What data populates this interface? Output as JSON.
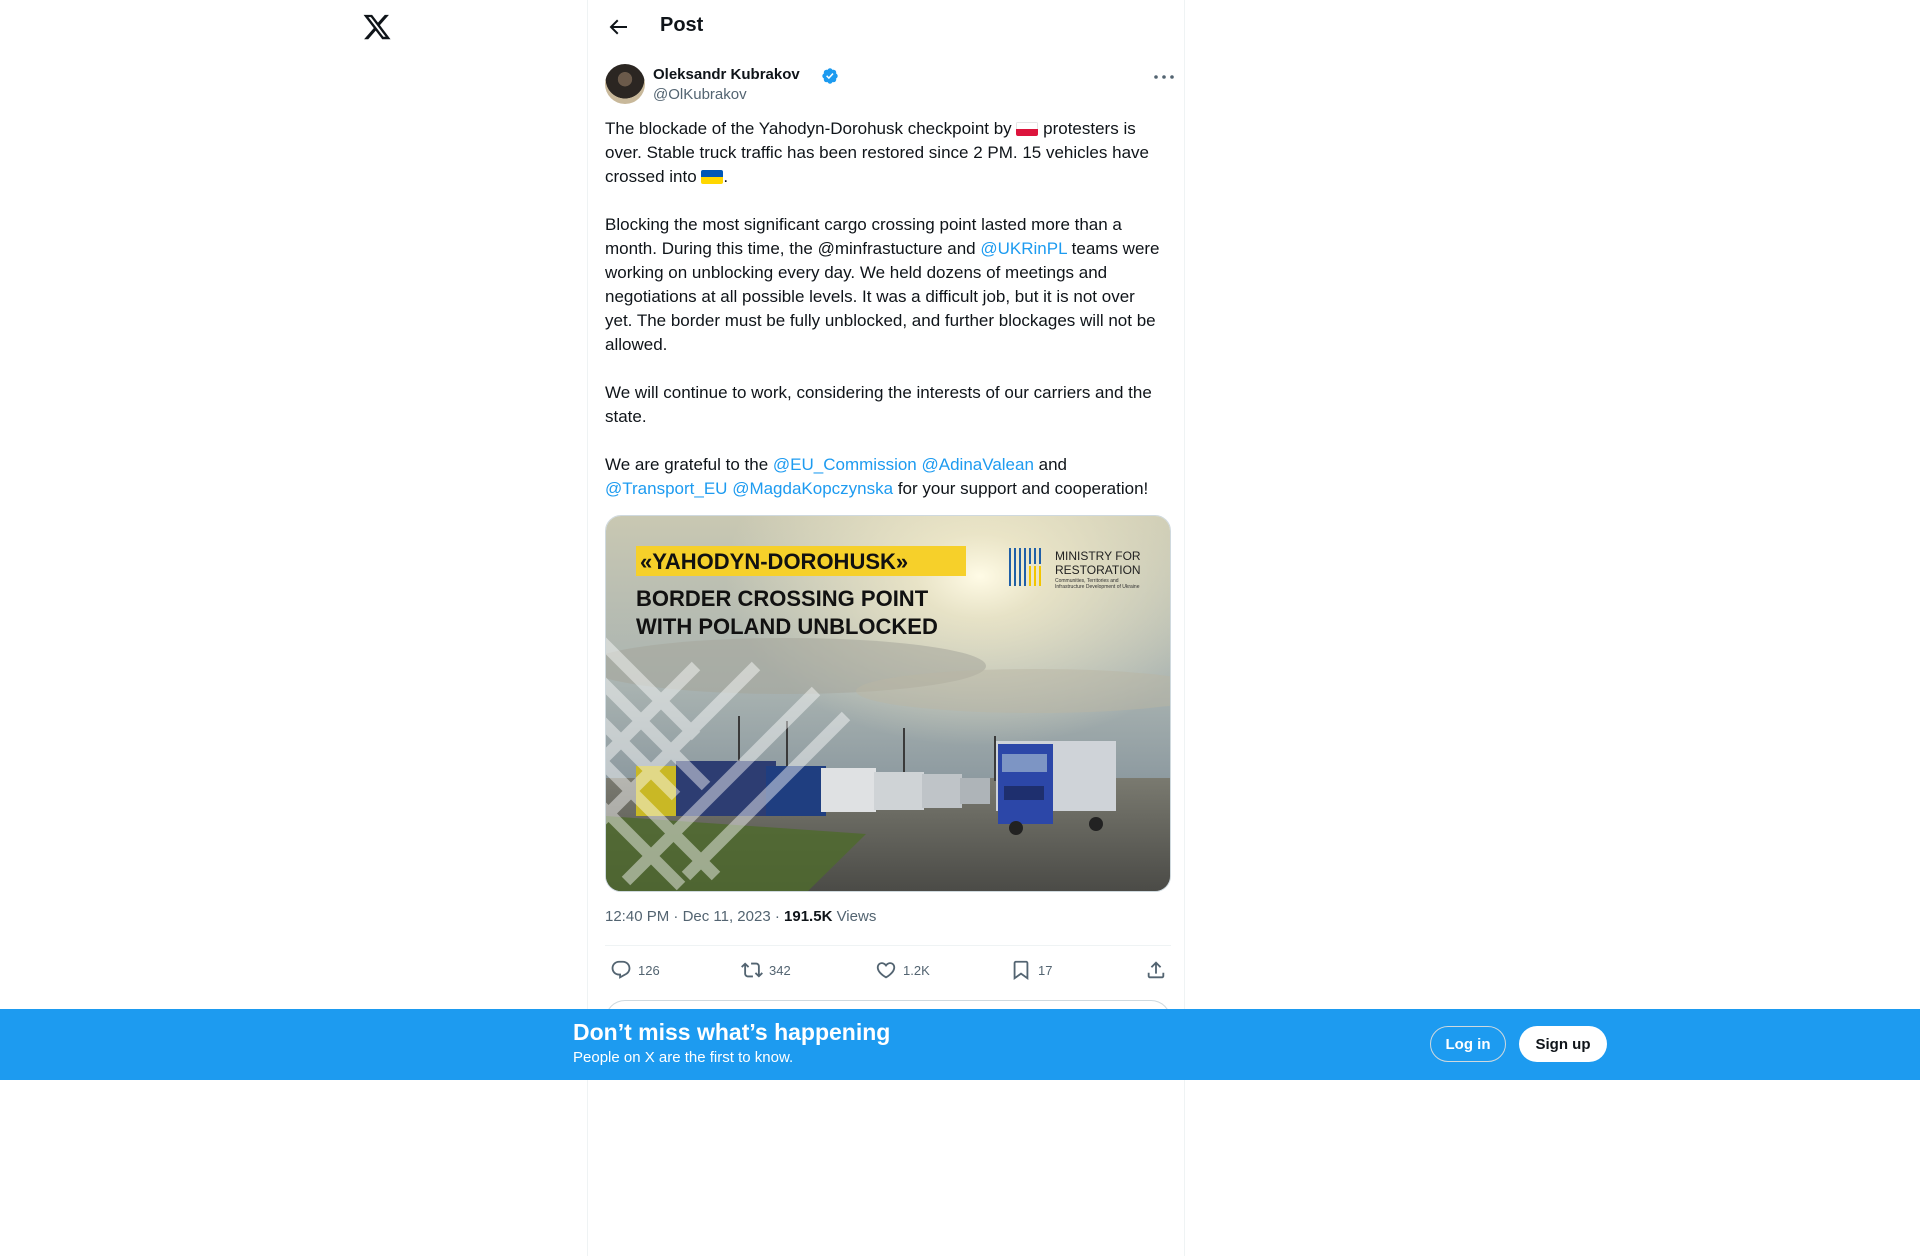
{
  "header": {
    "title": "Post",
    "logo_icon": "x-logo-icon",
    "back_icon": "arrow-left-icon"
  },
  "author": {
    "name": "Oleksandr Kubrakov",
    "handle": "@OlKubrakov",
    "verified": true
  },
  "tweet": {
    "p1_a": "The blockade of the Yahodyn-Dorohusk checkpoint by ",
    "p1_b": " protesters is over. Stable truck traffic has been restored since 2 PM. 15 vehicles have crossed into ",
    "p1_c": ".",
    "p2_a": "Blocking the most significant cargo crossing point lasted more than a month. During this time, the @minfrastucture and ",
    "p2_mention": "@UKRinPL",
    "p2_b": " teams were working on unblocking every day. We held dozens of meetings and negotiations at all possible levels. It was a difficult job, but it is not over yet. The border must be fully unblocked, and further blockages will not be allowed.",
    "p3": "We will continue to work, considering the interests of our carriers and the state.",
    "p4_a": "We are grateful to the ",
    "p4_m1": "@EU_Commission",
    "p4_m2": "@AdinaValean",
    "p4_b": " and",
    "p4_m3": "@Transport_EU",
    "p4_m4": "@MagdaKopczynska",
    "p4_c": " for your support and cooperation!",
    "flag_poland": {
      "top": "#ffffff",
      "bottom": "#dc143c"
    },
    "flag_ukraine": {
      "top": "#0057b7",
      "bottom": "#ffd700"
    }
  },
  "media": {
    "headline": "«YAHODYN-DOROHUSK»",
    "subhead_1": "BORDER CROSSING POINT",
    "subhead_2": "WITH POLAND UNBLOCKED",
    "brand_1": "MINISTRY FOR",
    "brand_2": "RESTORATION",
    "brand_small_1": "Communities, Territories and",
    "brand_small_2": "Infrastructure Development of Ukraine"
  },
  "meta": {
    "time": "12:40 PM",
    "sep1": " · ",
    "date": "Dec 11, 2023",
    "sep2": " · ",
    "views_count": "191.5K",
    "views_label": " Views"
  },
  "actions": {
    "replies": "126",
    "reposts": "342",
    "likes": "1.2K",
    "bookmarks": "17"
  },
  "banner": {
    "title": "Don’t miss what’s happening",
    "subtitle": "People on X are the first to know.",
    "login": "Log in",
    "signup": "Sign up"
  },
  "colors": {
    "accent": "#1d9bf0",
    "text": "#0f1419",
    "muted": "#536471"
  }
}
